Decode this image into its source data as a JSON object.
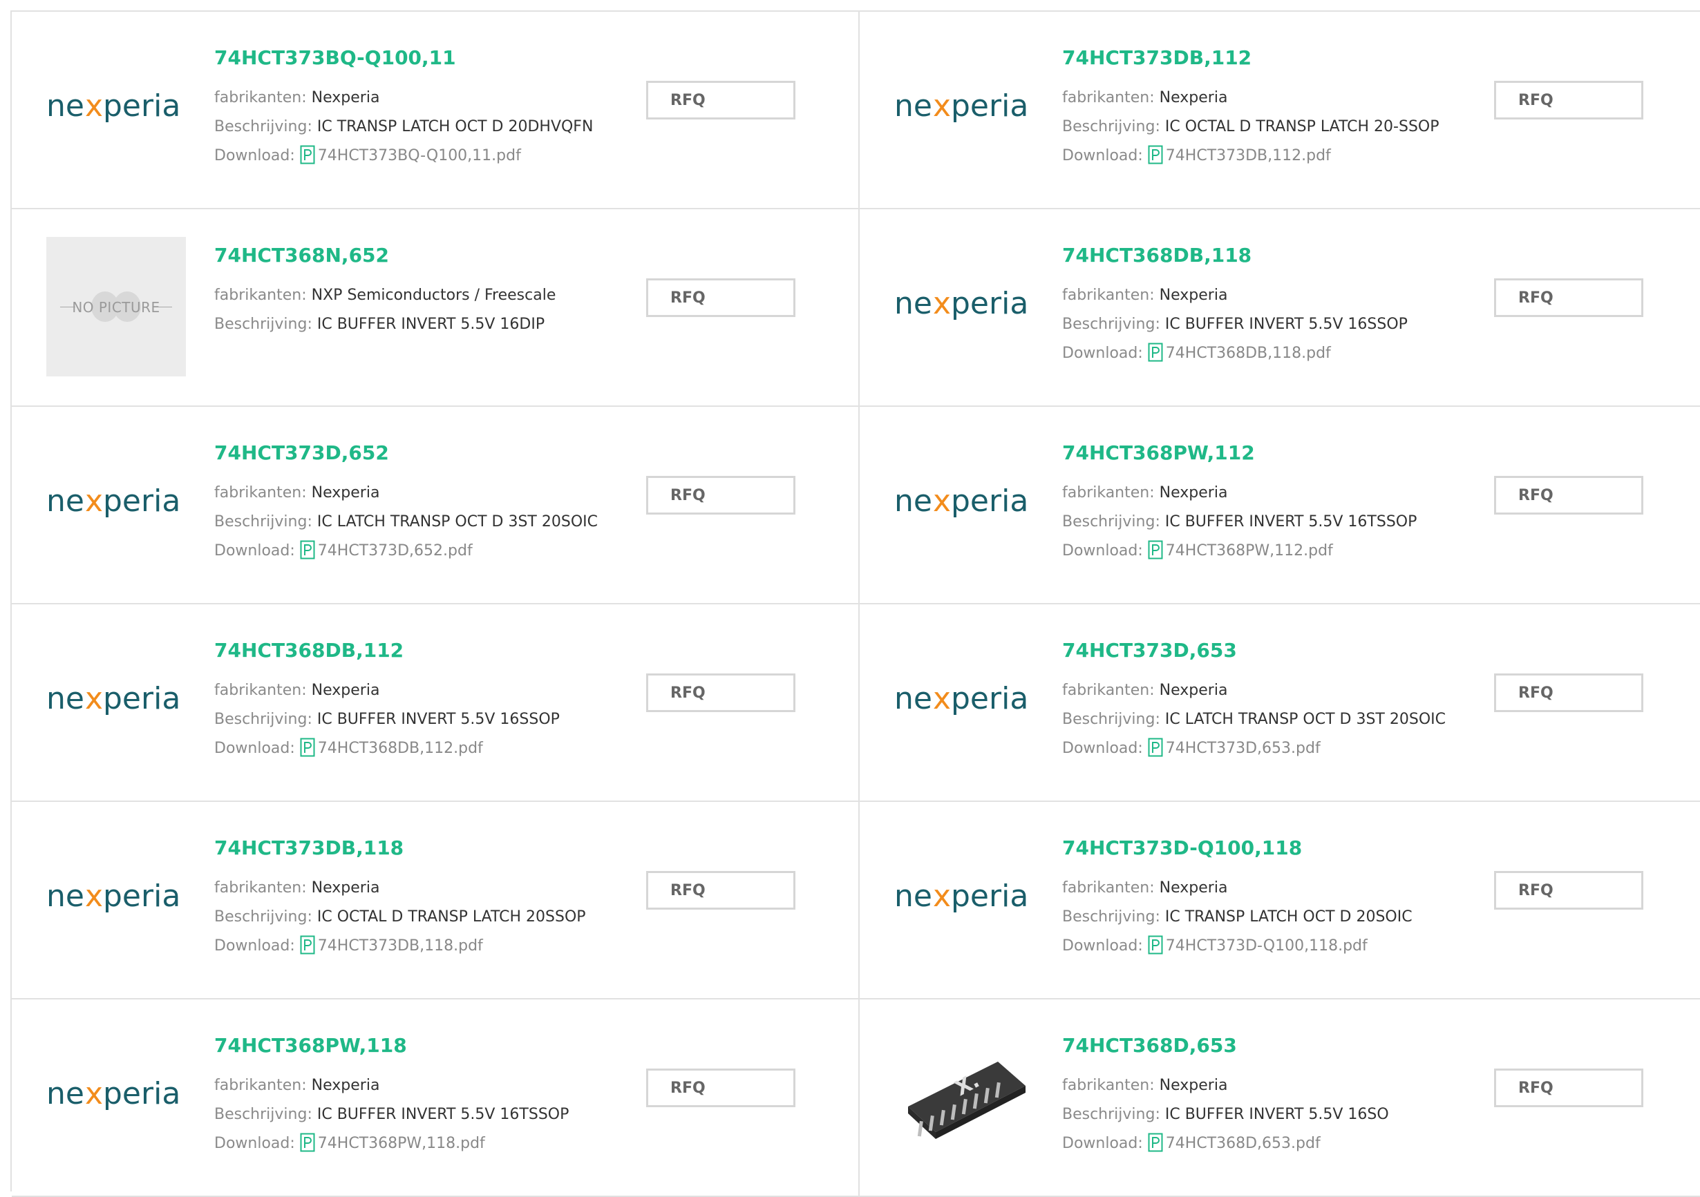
{
  "colors": {
    "accent": "#1fb887",
    "logo_teal": "#1a5e6a",
    "logo_orange": "#f28c1c",
    "border": "#e1e1e1"
  },
  "labels": {
    "manufacturer": "fabrikanten:",
    "description": "Beschrijving:",
    "download": "Download:",
    "rfq": "RFQ",
    "no_picture": "NO PICTURE",
    "logo_text": "nexperia"
  },
  "products": [
    {
      "part": "74HCT373BQ-Q100,11",
      "manufacturer": "Nexperia",
      "description": "IC TRANSP LATCH OCT D 20DHVQFN",
      "pdf": "74HCT373BQ-Q100,11.pdf",
      "image": "nexperia-logo"
    },
    {
      "part": "74HCT373DB,112",
      "manufacturer": "Nexperia",
      "description": "IC OCTAL D TRANSP LATCH 20-SSOP",
      "pdf": "74HCT373DB,112.pdf",
      "image": "nexperia-logo"
    },
    {
      "part": "74HCT368N,652",
      "manufacturer": "NXP Semiconductors / Freescale",
      "description": "IC BUFFER INVERT 5.5V 16DIP",
      "pdf": null,
      "image": "no-picture"
    },
    {
      "part": "74HCT368DB,118",
      "manufacturer": "Nexperia",
      "description": "IC BUFFER INVERT 5.5V 16SSOP",
      "pdf": "74HCT368DB,118.pdf",
      "image": "nexperia-logo"
    },
    {
      "part": "74HCT373D,652",
      "manufacturer": "Nexperia",
      "description": "IC LATCH TRANSP OCT D 3ST 20SOIC",
      "pdf": "74HCT373D,652.pdf",
      "image": "nexperia-logo"
    },
    {
      "part": "74HCT368PW,112",
      "manufacturer": "Nexperia",
      "description": "IC BUFFER INVERT 5.5V 16TSSOP",
      "pdf": "74HCT368PW,112.pdf",
      "image": "nexperia-logo"
    },
    {
      "part": "74HCT368DB,112",
      "manufacturer": "Nexperia",
      "description": "IC BUFFER INVERT 5.5V 16SSOP",
      "pdf": "74HCT368DB,112.pdf",
      "image": "nexperia-logo"
    },
    {
      "part": "74HCT373D,653",
      "manufacturer": "Nexperia",
      "description": "IC LATCH TRANSP OCT D 3ST 20SOIC",
      "pdf": "74HCT373D,653.pdf",
      "image": "nexperia-logo"
    },
    {
      "part": "74HCT373DB,118",
      "manufacturer": "Nexperia",
      "description": "IC OCTAL D TRANSP LATCH 20SSOP",
      "pdf": "74HCT373DB,118.pdf",
      "image": "nexperia-logo"
    },
    {
      "part": "74HCT373D-Q100,118",
      "manufacturer": "Nexperia",
      "description": "IC TRANSP LATCH OCT D 20SOIC",
      "pdf": "74HCT373D-Q100,118.pdf",
      "image": "nexperia-logo"
    },
    {
      "part": "74HCT368PW,118",
      "manufacturer": "Nexperia",
      "description": "IC BUFFER INVERT 5.5V 16TSSOP",
      "pdf": "74HCT368PW,118.pdf",
      "image": "nexperia-logo"
    },
    {
      "part": "74HCT368D,653",
      "manufacturer": "Nexperia",
      "description": "IC BUFFER INVERT 5.5V 16SO",
      "pdf": "74HCT368D,653.pdf",
      "image": "chip-photo"
    }
  ]
}
